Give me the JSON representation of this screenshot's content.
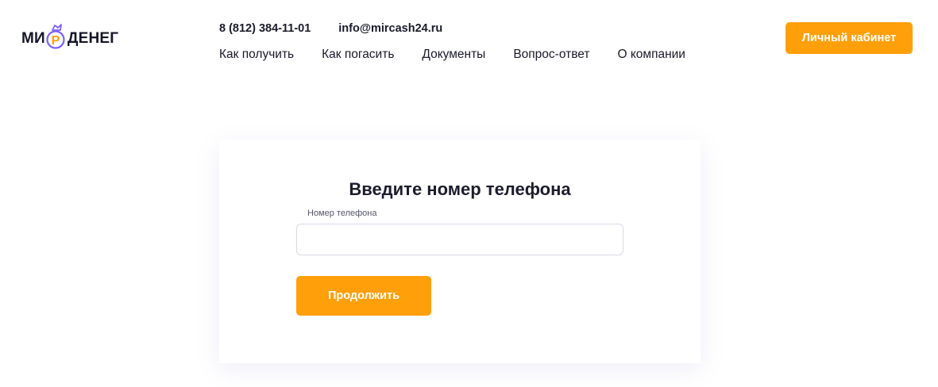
{
  "header": {
    "logo": {
      "word1": "МИ",
      "word2": "ДЕНЕГ",
      "mark_letter": "Р",
      "mark_icon": "ruble-coin-bag-icon"
    },
    "phone": "8 (812) 384-11-01",
    "email": "info@mircash24.ru",
    "nav": [
      {
        "label": "Как получить"
      },
      {
        "label": "Как погасить"
      },
      {
        "label": "Документы"
      },
      {
        "label": "Вопрос-ответ"
      },
      {
        "label": "О компании"
      }
    ],
    "cabinet_button": "Личный кабинет"
  },
  "form": {
    "title": "Введите номер телефона",
    "phone_label": "Номер телефона",
    "phone_value": "",
    "phone_placeholder": "",
    "submit_label": "Продолжить"
  },
  "colors": {
    "accent": "#ff9f0a",
    "logo_purple": "#7b61ff",
    "text": "#1f1f2e"
  }
}
